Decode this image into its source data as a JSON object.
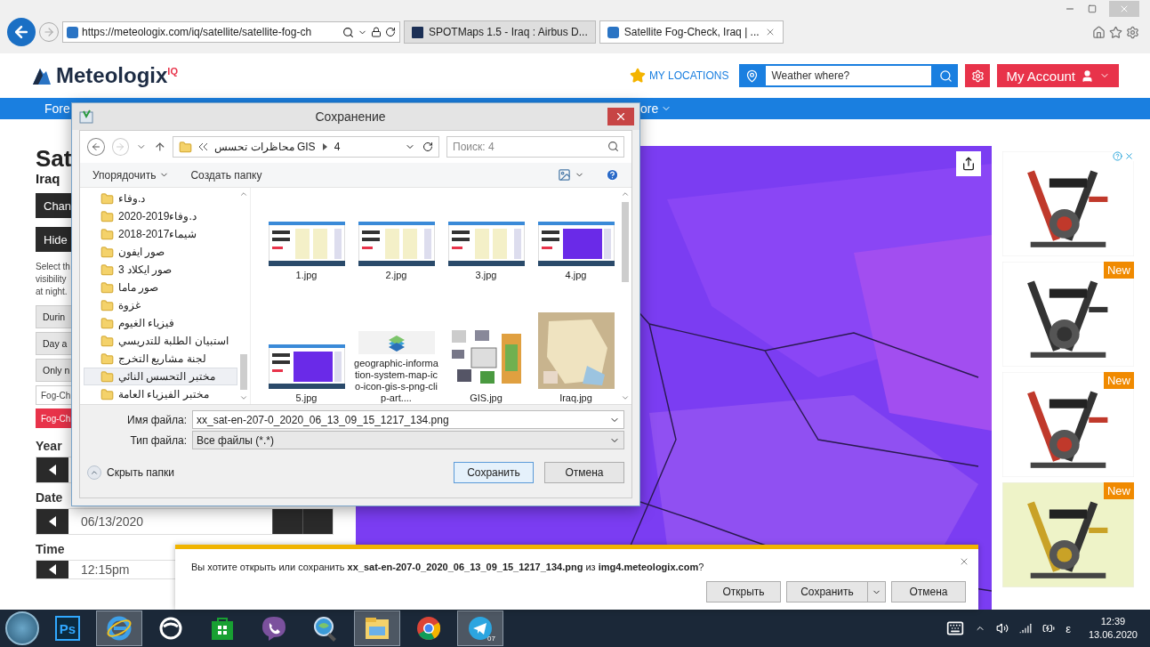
{
  "browser": {
    "url": "https://meteologix.com/iq/satellite/satellite-fog-ch",
    "tabs": [
      {
        "title": "SPOTMaps 1.5 - Iraq : Airbus D...",
        "kind": "airbus",
        "selected": false
      },
      {
        "title": "Satellite Fog-Check, Iraq | ...",
        "kind": "meteologix",
        "selected": true
      }
    ]
  },
  "header": {
    "logo": "Meteologix",
    "logo_sup": "IQ",
    "my_locations": "MY LOCATIONS",
    "search_placeholder": "Weather where?",
    "account": "My Account"
  },
  "nav": [
    {
      "label": "Fore",
      "menu": false
    },
    {
      "label": "ore",
      "menu": true
    }
  ],
  "sidebar": {
    "title": "Sat",
    "subtitle": "Iraq",
    "buttons": [
      "Chan",
      "Hide"
    ],
    "description": [
      "Select th",
      "visibility",
      "at night."
    ],
    "choices": [
      "Durin",
      "Day a",
      "Only n"
    ],
    "products": [
      {
        "label": "Fog-Ch",
        "selected": false
      },
      {
        "label": "Fog-Ch",
        "selected": true
      }
    ],
    "year_label": "Year",
    "date_label": "Date",
    "date": "06/13/2020",
    "time_label": "Time",
    "time": "12:15pm"
  },
  "ads": [
    {
      "kind": "adchoices"
    },
    {
      "kind": "new",
      "badge": "New"
    },
    {
      "kind": "new",
      "badge": "New"
    },
    {
      "kind": "new",
      "badge": "New"
    }
  ],
  "dialog": {
    "title": "Сохранение",
    "path": [
      "محاظرات تحسس GIS",
      "4"
    ],
    "search_placeholder": "Поиск: 4",
    "organize": "Упорядочить",
    "new_folder": "Создать папку",
    "folders": [
      {
        "name": "د.وفاء",
        "selected": false
      },
      {
        "name": "2020-2019د.وفاء",
        "selected": false
      },
      {
        "name": "2018-2017شيماء",
        "selected": false
      },
      {
        "name": "صور ايفون",
        "selected": false
      },
      {
        "name": "3 صور ايكلاد",
        "selected": false
      },
      {
        "name": "صور ماما",
        "selected": false
      },
      {
        "name": "غزوة",
        "selected": false
      },
      {
        "name": "فيزياء الغيوم",
        "selected": false
      },
      {
        "name": "استبيان الطلبة للتدريسي",
        "selected": false
      },
      {
        "name": "لجنة مشاريع التخرج",
        "selected": false
      },
      {
        "name": "مختبر التحسس النائي",
        "selected": true
      },
      {
        "name": "مختبر الفيزياء العامة",
        "selected": false
      }
    ],
    "files": [
      {
        "name": "1.jpg",
        "kind": "page"
      },
      {
        "name": "2.jpg",
        "kind": "page"
      },
      {
        "name": "3.jpg",
        "kind": "page"
      },
      {
        "name": "4.jpg",
        "kind": "satellite"
      },
      {
        "name": "5.jpg",
        "kind": "satellite"
      },
      {
        "name": "geographic-information-system-map-ico-icon-gis-s-png-clip-art....",
        "kind": "icon"
      },
      {
        "name": "GIS.jpg",
        "kind": "diagram"
      },
      {
        "name": "Iraq.jpg",
        "kind": "map"
      }
    ],
    "filename_label": "Имя файла:",
    "filename": "xx_sat-en-207-0_2020_06_13_09_15_1217_134.png",
    "type_label": "Тип файла:",
    "type": "Все файлы (*.*)",
    "hide_folders": "Скрыть папки",
    "save": "Сохранить",
    "cancel": "Отмена"
  },
  "download": {
    "message": "Вы хотите открыть или сохранить **xx_sat-en-207-0_2020_06_13_09_15_1217_134.png** из **img4.meteologix.com**?",
    "open": "Открыть",
    "save": "Сохранить",
    "cancel": "Отмена"
  },
  "taskbar": {
    "apps": [
      {
        "kind": "photoshop",
        "label": "Ps",
        "active": false
      },
      {
        "kind": "ie",
        "active": true
      },
      {
        "kind": "opera",
        "active": false
      },
      {
        "kind": "store",
        "active": false
      },
      {
        "kind": "viber",
        "active": false
      },
      {
        "kind": "search",
        "active": false
      },
      {
        "kind": "explorer",
        "active": true
      },
      {
        "kind": "chrome",
        "active": false
      },
      {
        "kind": "telegram",
        "badge": "07",
        "active": true
      }
    ],
    "language": "ε",
    "time": "12:39",
    "date": "13.06.2020"
  }
}
